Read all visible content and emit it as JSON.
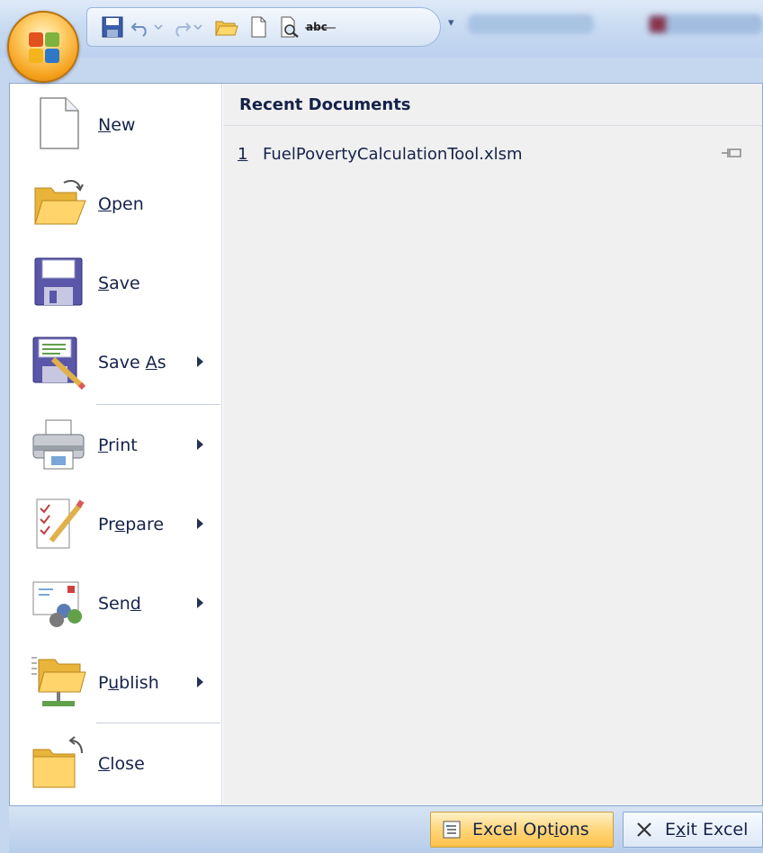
{
  "quick_access": {
    "icons": [
      "save-icon",
      "undo-icon",
      "redo-icon",
      "open-folder-icon",
      "new-doc-icon",
      "print-preview-icon",
      "spelling-icon",
      "customize-icon"
    ]
  },
  "left_menu": {
    "items": [
      {
        "pre": "",
        "u": "N",
        "post": "ew",
        "icon": "new-document-icon",
        "submenu": false
      },
      {
        "pre": "",
        "u": "O",
        "post": "pen",
        "icon": "open-folder-icon",
        "submenu": false
      },
      {
        "pre": "",
        "u": "S",
        "post": "ave",
        "icon": "save-icon",
        "submenu": false
      },
      {
        "pre": "Save ",
        "u": "A",
        "post": "s",
        "icon": "save-as-icon",
        "submenu": true
      },
      {
        "pre": "",
        "u": "P",
        "post": "rint",
        "icon": "printer-icon",
        "submenu": true
      },
      {
        "pre": "Pr",
        "u": "e",
        "post": "pare",
        "icon": "prepare-icon",
        "submenu": true
      },
      {
        "pre": "Sen",
        "u": "d",
        "post": "",
        "icon": "send-icon",
        "submenu": true
      },
      {
        "pre": "P",
        "u": "u",
        "post": "blish",
        "icon": "publish-icon",
        "submenu": true
      },
      {
        "pre": "",
        "u": "C",
        "post": "lose",
        "icon": "close-folder-icon",
        "submenu": false
      }
    ]
  },
  "recent": {
    "heading": "Recent Documents",
    "documents": [
      {
        "number": "1",
        "name": "FuelPovertyCalculationTool.xlsm"
      }
    ]
  },
  "bottom": {
    "options": {
      "pre": "Excel Opt",
      "u": "i",
      "post": "ons"
    },
    "exit": {
      "pre": "E",
      "u": "x",
      "post": "it Excel"
    }
  }
}
